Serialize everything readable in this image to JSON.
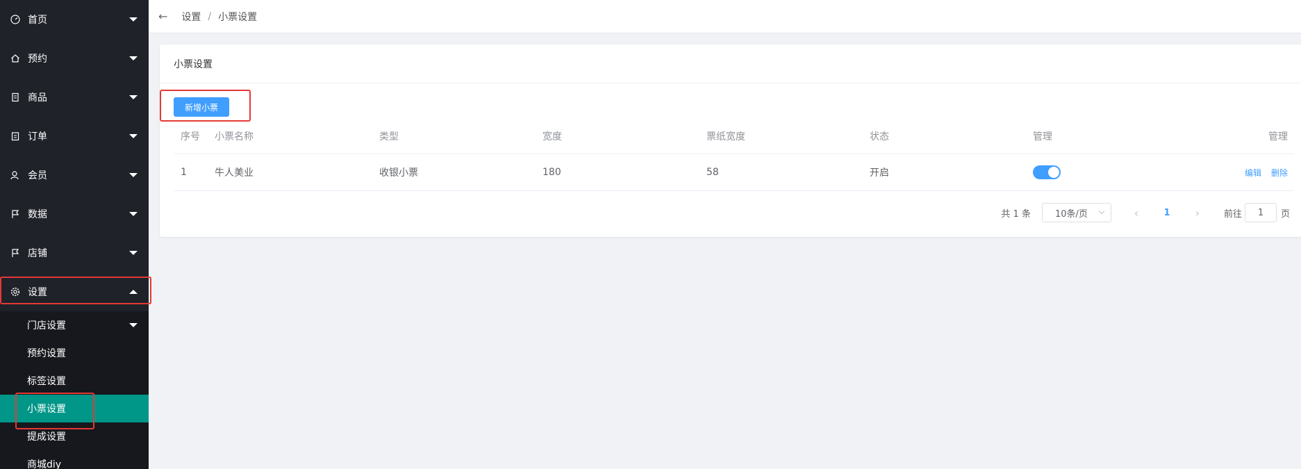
{
  "sidebar": {
    "items": [
      {
        "label": "首页",
        "icon": "dashboard-icon"
      },
      {
        "label": "预约",
        "icon": "home-icon"
      },
      {
        "label": "商品",
        "icon": "document-icon"
      },
      {
        "label": "订单",
        "icon": "clipboard-icon"
      },
      {
        "label": "会员",
        "icon": "user-icon"
      },
      {
        "label": "数据",
        "icon": "flag-icon"
      },
      {
        "label": "店铺",
        "icon": "flag-icon"
      },
      {
        "label": "设置",
        "icon": "gear-icon"
      }
    ],
    "settings_sub": [
      {
        "label": "门店设置"
      },
      {
        "label": "预约设置"
      },
      {
        "label": "标签设置"
      },
      {
        "label": "小票设置"
      },
      {
        "label": "提成设置"
      },
      {
        "label": "商城diy"
      }
    ],
    "active_color": "#009688"
  },
  "header": {
    "back": "←",
    "breadcrumb_parent": "设置",
    "breadcrumb_sep": "/",
    "breadcrumb_current": "小票设置"
  },
  "card": {
    "title": "小票设置",
    "add_button": "新增小票"
  },
  "table": {
    "headers": [
      "序号",
      "小票名称",
      "类型",
      "宽度",
      "票纸宽度",
      "状态",
      "管理",
      "管理"
    ],
    "rows": [
      {
        "index": "1",
        "name": "牛人美业",
        "type": "收银小票",
        "width": "180",
        "paper_width": "58",
        "status": "开启",
        "enabled": true,
        "edit": "编辑",
        "delete": "删除"
      }
    ]
  },
  "pagination": {
    "total": "共 1 条",
    "page_size": "10条/页",
    "prev": "‹",
    "current": "1",
    "next": "›",
    "goto_label": "前往",
    "goto_value": "1",
    "page_label": "页"
  },
  "colors": {
    "primary": "#409eff",
    "sidebar_bg": "#1f2229",
    "highlight_box": "#e53935"
  }
}
